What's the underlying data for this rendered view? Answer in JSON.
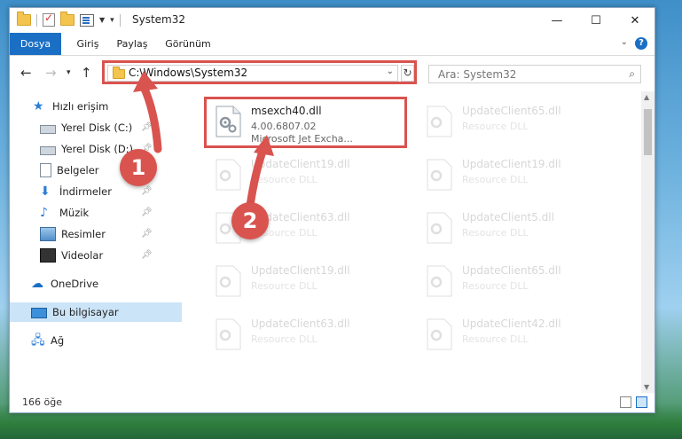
{
  "window": {
    "title": "System32",
    "controls": {
      "minimize": "—",
      "maximize": "☐",
      "close": "✕"
    }
  },
  "ribbon": {
    "tabs": [
      {
        "label": "Dosya"
      },
      {
        "label": "Giriş"
      },
      {
        "label": "Paylaş"
      },
      {
        "label": "Görünüm"
      }
    ],
    "help": "?"
  },
  "nav": {
    "address": "C:\\Windows\\System32",
    "refresh_icon": "↻",
    "search_placeholder": "Ara: System32",
    "search_icon": "⌕"
  },
  "sidebar": {
    "items": [
      {
        "label": "Hızlı erişim",
        "icon": "star-icon"
      },
      {
        "label": "Yerel Disk (C:)",
        "icon": "drive-icon"
      },
      {
        "label": "Yerel Disk (D:)",
        "icon": "drive-icon"
      },
      {
        "label": "Belgeler",
        "icon": "documents-icon"
      },
      {
        "label": "İndirmeler",
        "icon": "download-icon"
      },
      {
        "label": "Müzik",
        "icon": "music-icon"
      },
      {
        "label": "Resimler",
        "icon": "pictures-icon"
      },
      {
        "label": "Videolar",
        "icon": "video-icon"
      },
      {
        "label": "OneDrive",
        "icon": "cloud-icon"
      },
      {
        "label": "Bu bilgisayar",
        "icon": "computer-icon"
      },
      {
        "label": "Ağ",
        "icon": "network-icon"
      }
    ]
  },
  "files": [
    {
      "name": "msexch40.dll",
      "version": "4.00.6807.02",
      "desc": "Microsoft Jet Excha..."
    },
    {
      "name": "UpdateClient65.dll",
      "desc": "Resource DLL"
    },
    {
      "name": "UpdateClient19.dll",
      "desc": "Resource DLL"
    },
    {
      "name": "UpdateClient19.dll",
      "desc": "Resource DLL"
    },
    {
      "name": "UpdateClient63.dll",
      "desc": "Resource DLL"
    },
    {
      "name": "UpdateClient5.dll",
      "desc": "Resource DLL"
    },
    {
      "name": "UpdateClient19.dll",
      "desc": "Resource DLL"
    },
    {
      "name": "UpdateClient65.dll",
      "desc": "Resource DLL"
    },
    {
      "name": "UpdateClient63.dll",
      "desc": "Resource DLL"
    },
    {
      "name": "UpdateClient42.dll",
      "desc": "Resource DLL"
    }
  ],
  "status": {
    "count": "166 öğe"
  },
  "annotations": {
    "step1": "1",
    "step2": "2",
    "color": "#d9534f"
  }
}
